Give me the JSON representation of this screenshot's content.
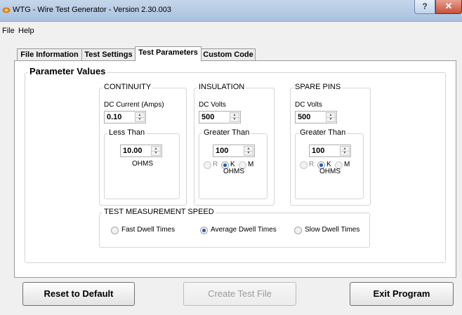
{
  "window": {
    "title": "WTG - Wire Test Generator - Version 2.30.003",
    "help_button": "?",
    "close_button": "✕"
  },
  "menu": [
    "File",
    "Help"
  ],
  "tabs": [
    {
      "label": "File Information",
      "active": false
    },
    {
      "label": "Test Settings",
      "active": false
    },
    {
      "label": "Test Parameters",
      "active": true
    },
    {
      "label": "Custom Code",
      "active": false
    }
  ],
  "parameter_values": {
    "title": "Parameter Values",
    "continuity": {
      "title": "CONTINUITY",
      "dc_label": "DC Current (Amps)",
      "dc_value": "0.10",
      "threshold_title": "Less Than",
      "threshold_value": "10.00",
      "unit": "OHMS"
    },
    "insulation": {
      "title": "INSULATION",
      "dc_label": "DC Volts",
      "dc_value": "500",
      "threshold_title": "Greater Than",
      "threshold_value": "100",
      "radios": [
        "R",
        "K",
        "M"
      ],
      "selected": "K",
      "unit": "OHMS"
    },
    "spare_pins": {
      "title": "SPARE PINS",
      "dc_label": "DC Volts",
      "dc_value": "500",
      "threshold_title": "Greater Than",
      "threshold_value": "100",
      "radios": [
        "R",
        "K",
        "M"
      ],
      "selected": "K",
      "unit": "OHMS"
    },
    "speed": {
      "title": "TEST MEASUREMENT SPEED",
      "options": [
        "Fast Dwell Times",
        "Average Dwell Times",
        "Slow Dwell Times"
      ],
      "selected": "Average Dwell Times"
    }
  },
  "buttons": {
    "reset": "Reset to Default",
    "create": "Create Test File",
    "exit": "Exit Program"
  },
  "icons": [
    "app-icon",
    "spin-up-icon",
    "spin-down-icon"
  ]
}
